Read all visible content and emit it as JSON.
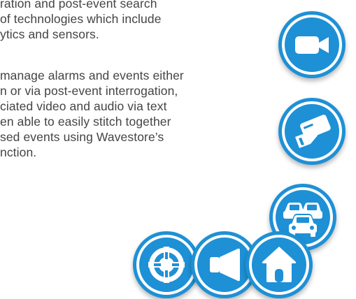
{
  "intro": {
    "lines": [
      "ration and post-event search",
      "of technologies which include",
      "ytics and sensors."
    ]
  },
  "detail": {
    "lines": [
      "manage alarms and events either",
      "n or via post-event interrogation,",
      "ciated video and audio via text",
      "en able to easily stitch together",
      "sed events using Wavestore’s",
      "nction."
    ]
  },
  "icons": {
    "camera": "video-camera-icon",
    "card": "access-card-icon",
    "traffic": "traffic-cars-icon",
    "target": "crosshair-target-icon",
    "speaker": "speaker-icon",
    "home": "home-icon"
  },
  "colors": {
    "accent": "#1e90d6",
    "text": "#444444",
    "background": "#ffffff"
  }
}
